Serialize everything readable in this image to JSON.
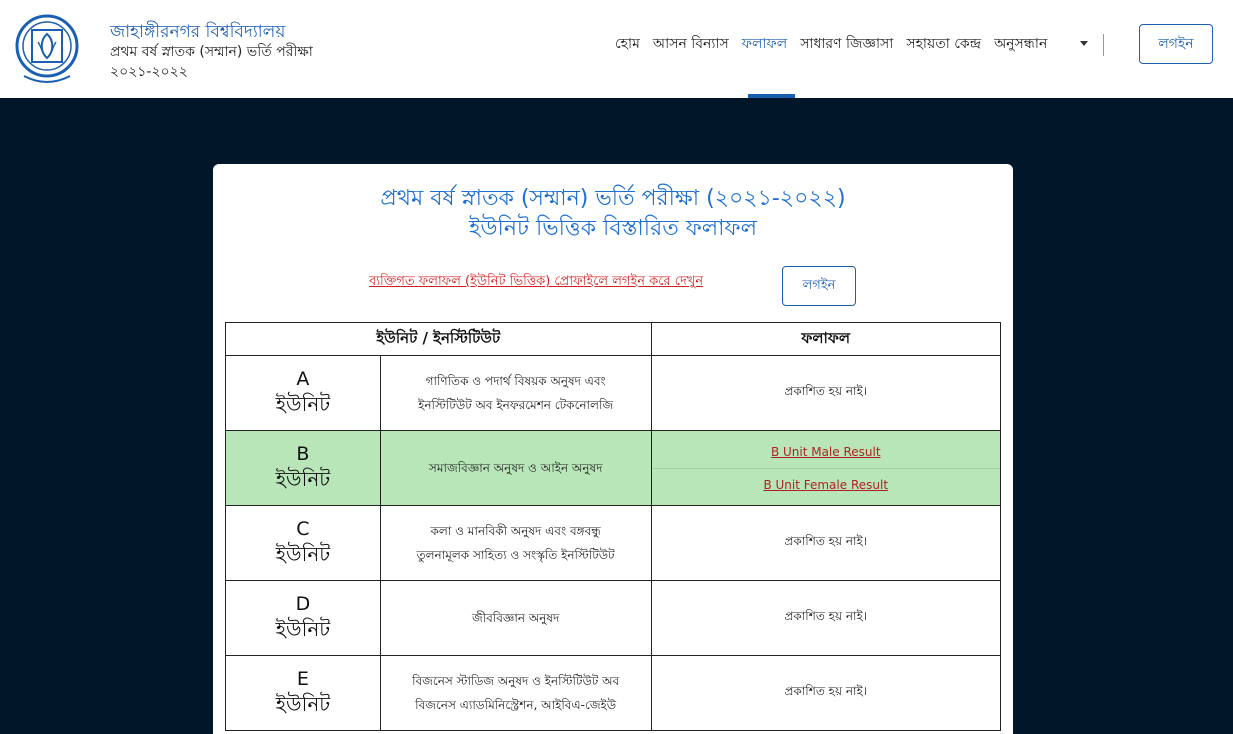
{
  "header": {
    "brand_name": "জাহাঙ্গীরনগর বিশ্ববিদ্যালয়",
    "brand_sub1": "প্রথম বর্ষ স্নাতক (সম্মান) ভর্তি পরীক্ষা",
    "brand_sub2": "২০২১-২০২২",
    "logo_icon": "university-seal-icon",
    "nav": [
      {
        "label": "হোম"
      },
      {
        "label": "আসন বিন্যাস"
      },
      {
        "label": "ফলাফল",
        "active": true
      },
      {
        "label": "সাধারণ জিজ্ঞাসা"
      },
      {
        "label": "সহায়তা কেন্দ্র"
      },
      {
        "label": "অনুসন্ধান"
      }
    ],
    "login_label": "লগইন"
  },
  "card": {
    "title_line1": "প্রথম বর্ষ স্নাতক (সম্মান) ভর্তি পরীক্ষা (২০২১-২০২২)",
    "title_line2": "ইউনিট ভিত্তিক বিস্তারিত ফলাফল",
    "notice": "ব্যক্তিগত ফলাফল (ইউনিট ভিত্তিক) প্রোফাইলে লগইন করে দেখুন",
    "login_label": "লগইন"
  },
  "table": {
    "headers": [
      "ইউনিট / ইনস্টিটিউট",
      "ফলাফল"
    ],
    "unit_word": "ইউনিট",
    "rows": [
      {
        "unit": "A",
        "inst_lines": [
          "গাণিতিক ও পদার্থ বিষয়ক অনুষদ এবং",
          "ইনস্টিটিউট অব ইনফরমেশন টেকনোলজি"
        ],
        "result": "প্রকাশিত হয় নাই।"
      },
      {
        "unit": "B",
        "inst_lines": [
          "সমাজবিজ্ঞান অনুষদ ও আইন অনুষদ"
        ],
        "links": [
          "B Unit Male Result",
          "B Unit Female Result"
        ]
      },
      {
        "unit": "C",
        "inst_lines": [
          "কলা ও মানবিকী অনুষদ এবং বঙ্গবন্ধু",
          "তুলনামূলক সাহিত্য ও সংস্কৃতি ইনস্টিটিউট"
        ],
        "result": "প্রকাশিত হয় নাই।"
      },
      {
        "unit": "D",
        "inst_lines": [
          "জীববিজ্ঞান অনুষদ"
        ],
        "result": "প্রকাশিত হয় নাই।"
      },
      {
        "unit": "E",
        "inst_lines": [
          "বিজনেস স্টাডিজ অনুষদ ও ইনস্টিটিউট অব",
          "বিজনেস এ্যাডমিনিস্ট্রেশন, আইবিএ-জেইউ"
        ],
        "result": "প্রকাশিত হয় নাই।"
      }
    ]
  },
  "colors": {
    "brand_blue": "#1b5fb3",
    "page_bg": "#021629",
    "highlight_green": "#b9e6b9",
    "notice_red": "#d61f1f"
  }
}
